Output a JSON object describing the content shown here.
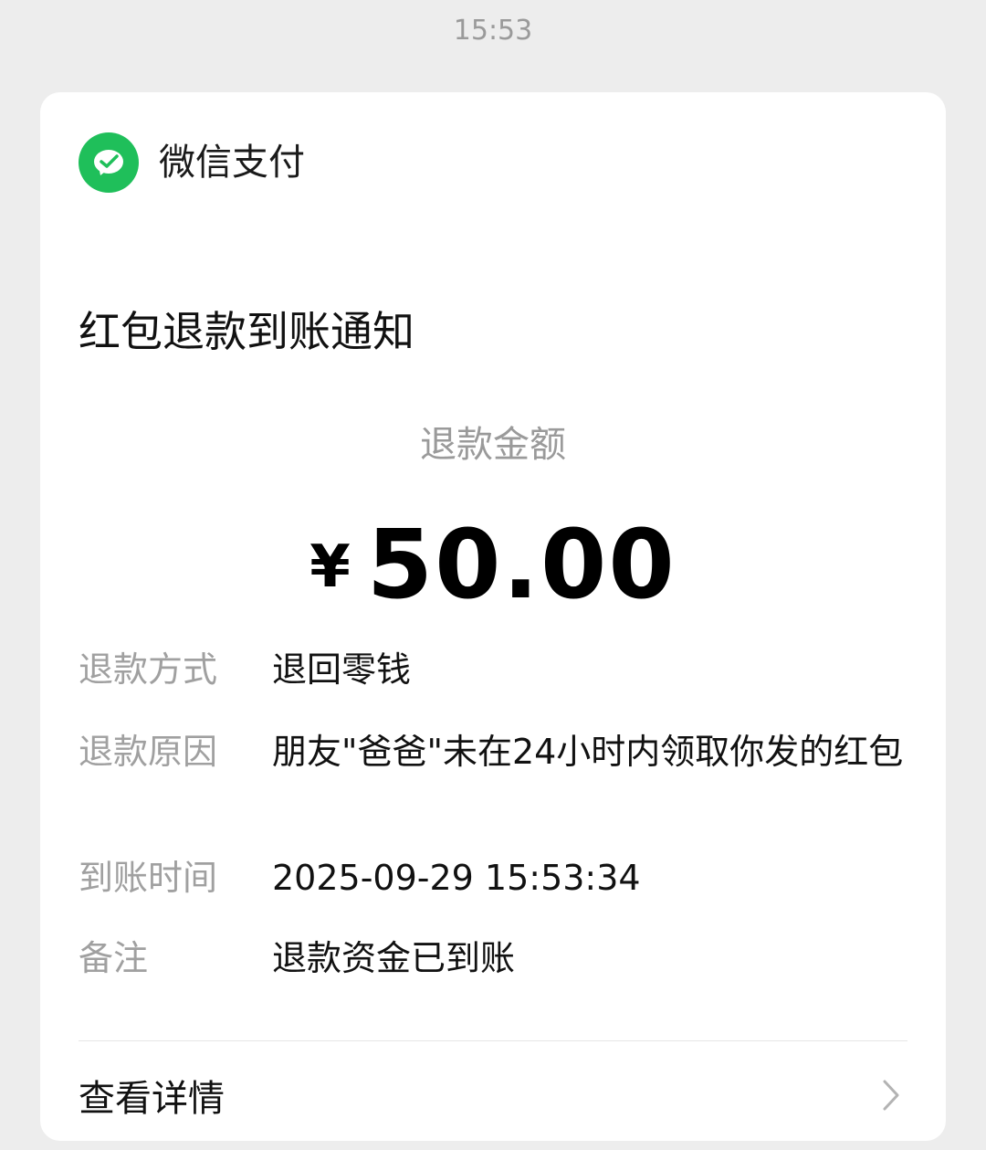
{
  "header": {
    "time": "15:53"
  },
  "brand": {
    "name": "微信支付",
    "icon": "wechat-pay-icon",
    "color": "#1fbf5a"
  },
  "notice": {
    "title": "红包退款到账通知",
    "amount_label": "退款金额",
    "currency": "¥",
    "amount": "50.00"
  },
  "details": [
    {
      "label": "退款方式",
      "value": "退回零钱"
    },
    {
      "label": "退款原因",
      "value": "朋友\"爸爸\"未在24小时内领取你发的红包"
    },
    {
      "label": "到账时间",
      "value": "2025-09-29 15:53:34"
    },
    {
      "label": "备注",
      "value": "退款资金已到账"
    }
  ],
  "footer": {
    "view_details": "查看详情",
    "icon": "chevron-right-icon"
  }
}
